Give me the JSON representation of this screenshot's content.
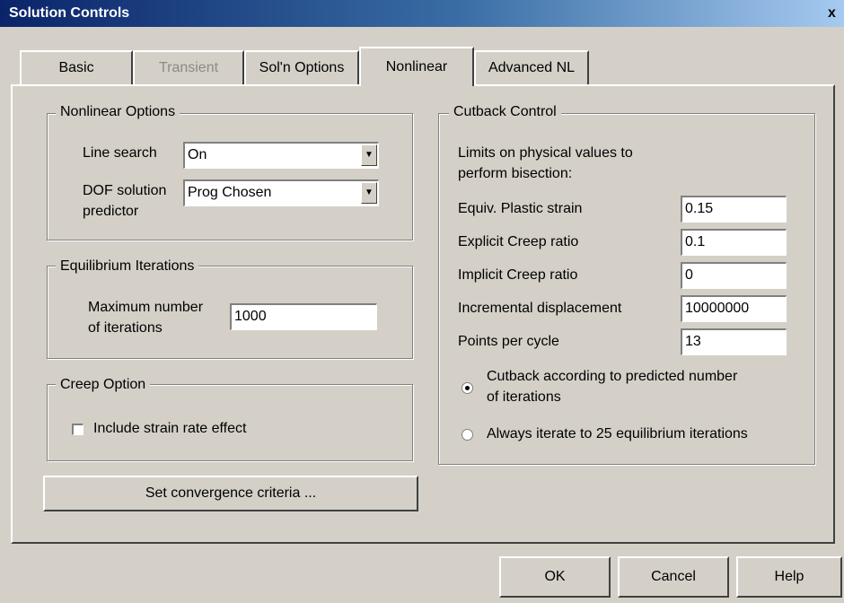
{
  "window": {
    "title": "Solution Controls",
    "close": "x"
  },
  "tabs": [
    {
      "label": "Basic"
    },
    {
      "label": "Transient"
    },
    {
      "label": "Sol'n Options"
    },
    {
      "label": "Nonlinear"
    },
    {
      "label": "Advanced NL"
    }
  ],
  "nonlinear_options": {
    "title": "Nonlinear Options",
    "line_search_label": "Line search",
    "line_search_value": "On",
    "dof_label_1": "DOF solution",
    "dof_label_2": "predictor",
    "dof_value": "Prog Chosen"
  },
  "equilibrium": {
    "title": "Equilibrium Iterations",
    "max_label_1": "Maximum number",
    "max_label_2": "of iterations",
    "max_value": "1000"
  },
  "creep": {
    "title": "Creep Option",
    "include_label": "Include strain rate effect"
  },
  "convergence_button": "Set convergence criteria ...",
  "cutback": {
    "title": "Cutback Control",
    "intro_1": "Limits on physical values to",
    "intro_2": "perform bisection:",
    "rows": [
      {
        "label": "Equiv. Plastic strain",
        "value": "0.15"
      },
      {
        "label": "Explicit Creep ratio",
        "value": "0.1"
      },
      {
        "label": "Implicit Creep ratio",
        "value": "0"
      },
      {
        "label": "Incremental displacement",
        "value": "10000000"
      },
      {
        "label": "Points per cycle",
        "value": "13"
      }
    ],
    "radio1_line1": "Cutback according to predicted number",
    "radio1_line2": "of iterations",
    "radio2": "Always iterate to 25 equilibrium iterations"
  },
  "buttons": {
    "ok": "OK",
    "cancel": "Cancel",
    "help": "Help"
  }
}
